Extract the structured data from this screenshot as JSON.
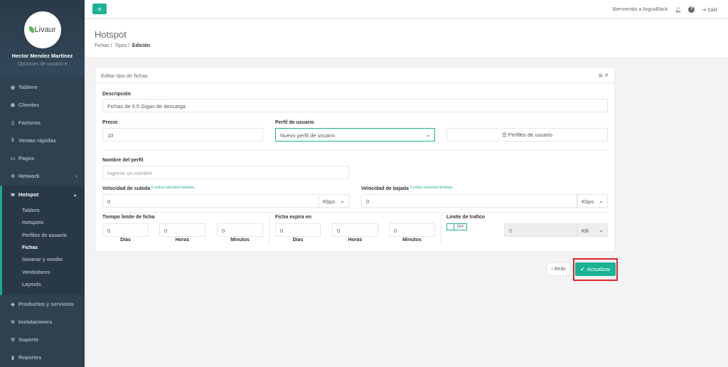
{
  "sidebar": {
    "logo_text": "Livaur",
    "user_name": "Hector Mendez Martínez",
    "user_options": "Opciones de usuario",
    "items": [
      {
        "label": "Tablero",
        "icon": "dashboard-icon"
      },
      {
        "label": "Clientes",
        "icon": "users-icon"
      },
      {
        "label": "Facturas",
        "icon": "file-icon"
      },
      {
        "label": "Ventas rápidas",
        "icon": "dollar-icon"
      },
      {
        "label": "Pagos",
        "icon": "money-icon"
      },
      {
        "label": "Network",
        "icon": "network-icon"
      },
      {
        "label": "Hotspot",
        "icon": "wifi-icon"
      },
      {
        "label": "Productos y servicios",
        "icon": "tag-icon"
      },
      {
        "label": "Instalaciones",
        "icon": "gear-icon"
      },
      {
        "label": "Soporte",
        "icon": "wrench-icon"
      },
      {
        "label": "Reportes",
        "icon": "book-icon"
      }
    ],
    "hotspot_sub": [
      "Tablero",
      "Hotspots",
      "Perfiles de usuario",
      "Fichas",
      "Generar y vender",
      "Vendedores",
      "Layouts"
    ]
  },
  "topbar": {
    "welcome": "Bienvenido a ArgusBlack",
    "logout": "Salir"
  },
  "header": {
    "title": "Hotspot",
    "breadcrumb": [
      "Fichas",
      "Tipos",
      "Edición"
    ]
  },
  "panel": {
    "title": "Editar tipo de fichas",
    "descripcion_label": "Descripción",
    "descripcion_value": "Fichas de 0.5 Gigas de descarga",
    "precio_label": "Precio",
    "precio_value": "10",
    "perfil_label": "Perfil de usuario",
    "perfil_value": "Nuevo perfil de usuario",
    "perfiles_button": "Perfiles de usuario",
    "nombre_perfil_label": "Nombre del perfil",
    "nombre_perfil_placeholder": "Ingrese un nombre",
    "vel_subida_label": "Velocidad de subida",
    "vel_subida_hint": "0 indica velocidad ilimitada",
    "vel_subida_value": "0",
    "vel_subida_unit": "Kbps",
    "vel_bajada_label": "Velocidad de bajada",
    "vel_bajada_hint": "0 indica velocidad ilimitada",
    "vel_bajada_value": "0",
    "vel_bajada_unit": "Kbps",
    "tiempo_label": "Tiempo limite de ficha",
    "expira_label": "Ficha expira en",
    "limite_label": "Limite de trafico",
    "toggle_text": "OFF",
    "tiempo_values": [
      "0",
      "0",
      "0"
    ],
    "expira_values": [
      "0",
      "0",
      "0"
    ],
    "unit_labels": [
      "Dias",
      "Horas",
      "Minutos"
    ],
    "limite_value": "0",
    "limite_unit": "KB"
  },
  "actions": {
    "back": "‹ Atrás",
    "update": "Actualizar"
  }
}
